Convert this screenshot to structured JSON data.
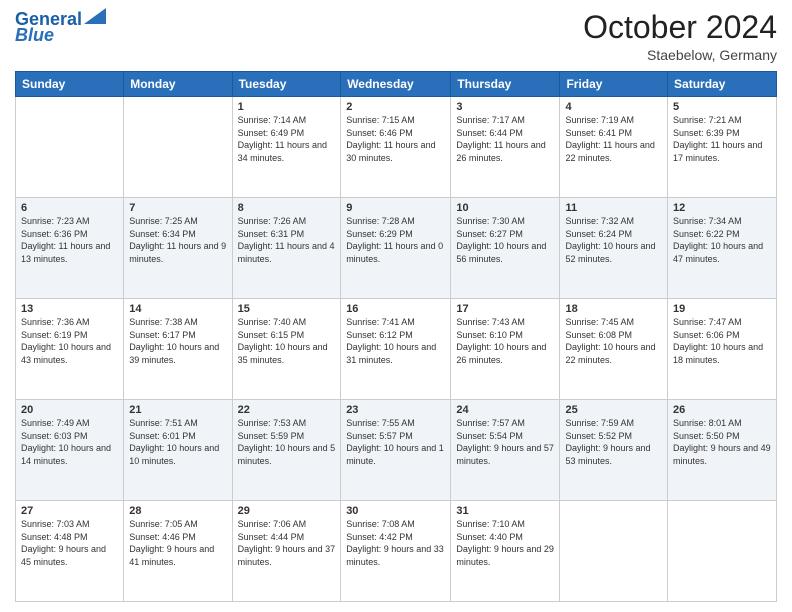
{
  "header": {
    "logo_line1": "General",
    "logo_line2": "Blue",
    "month": "October 2024",
    "location": "Staebelow, Germany"
  },
  "days_of_week": [
    "Sunday",
    "Monday",
    "Tuesday",
    "Wednesday",
    "Thursday",
    "Friday",
    "Saturday"
  ],
  "weeks": [
    [
      {
        "day": "",
        "info": ""
      },
      {
        "day": "",
        "info": ""
      },
      {
        "day": "1",
        "info": "Sunrise: 7:14 AM\nSunset: 6:49 PM\nDaylight: 11 hours and 34 minutes."
      },
      {
        "day": "2",
        "info": "Sunrise: 7:15 AM\nSunset: 6:46 PM\nDaylight: 11 hours and 30 minutes."
      },
      {
        "day": "3",
        "info": "Sunrise: 7:17 AM\nSunset: 6:44 PM\nDaylight: 11 hours and 26 minutes."
      },
      {
        "day": "4",
        "info": "Sunrise: 7:19 AM\nSunset: 6:41 PM\nDaylight: 11 hours and 22 minutes."
      },
      {
        "day": "5",
        "info": "Sunrise: 7:21 AM\nSunset: 6:39 PM\nDaylight: 11 hours and 17 minutes."
      }
    ],
    [
      {
        "day": "6",
        "info": "Sunrise: 7:23 AM\nSunset: 6:36 PM\nDaylight: 11 hours and 13 minutes."
      },
      {
        "day": "7",
        "info": "Sunrise: 7:25 AM\nSunset: 6:34 PM\nDaylight: 11 hours and 9 minutes."
      },
      {
        "day": "8",
        "info": "Sunrise: 7:26 AM\nSunset: 6:31 PM\nDaylight: 11 hours and 4 minutes."
      },
      {
        "day": "9",
        "info": "Sunrise: 7:28 AM\nSunset: 6:29 PM\nDaylight: 11 hours and 0 minutes."
      },
      {
        "day": "10",
        "info": "Sunrise: 7:30 AM\nSunset: 6:27 PM\nDaylight: 10 hours and 56 minutes."
      },
      {
        "day": "11",
        "info": "Sunrise: 7:32 AM\nSunset: 6:24 PM\nDaylight: 10 hours and 52 minutes."
      },
      {
        "day": "12",
        "info": "Sunrise: 7:34 AM\nSunset: 6:22 PM\nDaylight: 10 hours and 47 minutes."
      }
    ],
    [
      {
        "day": "13",
        "info": "Sunrise: 7:36 AM\nSunset: 6:19 PM\nDaylight: 10 hours and 43 minutes."
      },
      {
        "day": "14",
        "info": "Sunrise: 7:38 AM\nSunset: 6:17 PM\nDaylight: 10 hours and 39 minutes."
      },
      {
        "day": "15",
        "info": "Sunrise: 7:40 AM\nSunset: 6:15 PM\nDaylight: 10 hours and 35 minutes."
      },
      {
        "day": "16",
        "info": "Sunrise: 7:41 AM\nSunset: 6:12 PM\nDaylight: 10 hours and 31 minutes."
      },
      {
        "day": "17",
        "info": "Sunrise: 7:43 AM\nSunset: 6:10 PM\nDaylight: 10 hours and 26 minutes."
      },
      {
        "day": "18",
        "info": "Sunrise: 7:45 AM\nSunset: 6:08 PM\nDaylight: 10 hours and 22 minutes."
      },
      {
        "day": "19",
        "info": "Sunrise: 7:47 AM\nSunset: 6:06 PM\nDaylight: 10 hours and 18 minutes."
      }
    ],
    [
      {
        "day": "20",
        "info": "Sunrise: 7:49 AM\nSunset: 6:03 PM\nDaylight: 10 hours and 14 minutes."
      },
      {
        "day": "21",
        "info": "Sunrise: 7:51 AM\nSunset: 6:01 PM\nDaylight: 10 hours and 10 minutes."
      },
      {
        "day": "22",
        "info": "Sunrise: 7:53 AM\nSunset: 5:59 PM\nDaylight: 10 hours and 5 minutes."
      },
      {
        "day": "23",
        "info": "Sunrise: 7:55 AM\nSunset: 5:57 PM\nDaylight: 10 hours and 1 minute."
      },
      {
        "day": "24",
        "info": "Sunrise: 7:57 AM\nSunset: 5:54 PM\nDaylight: 9 hours and 57 minutes."
      },
      {
        "day": "25",
        "info": "Sunrise: 7:59 AM\nSunset: 5:52 PM\nDaylight: 9 hours and 53 minutes."
      },
      {
        "day": "26",
        "info": "Sunrise: 8:01 AM\nSunset: 5:50 PM\nDaylight: 9 hours and 49 minutes."
      }
    ],
    [
      {
        "day": "27",
        "info": "Sunrise: 7:03 AM\nSunset: 4:48 PM\nDaylight: 9 hours and 45 minutes."
      },
      {
        "day": "28",
        "info": "Sunrise: 7:05 AM\nSunset: 4:46 PM\nDaylight: 9 hours and 41 minutes."
      },
      {
        "day": "29",
        "info": "Sunrise: 7:06 AM\nSunset: 4:44 PM\nDaylight: 9 hours and 37 minutes."
      },
      {
        "day": "30",
        "info": "Sunrise: 7:08 AM\nSunset: 4:42 PM\nDaylight: 9 hours and 33 minutes."
      },
      {
        "day": "31",
        "info": "Sunrise: 7:10 AM\nSunset: 4:40 PM\nDaylight: 9 hours and 29 minutes."
      },
      {
        "day": "",
        "info": ""
      },
      {
        "day": "",
        "info": ""
      }
    ]
  ]
}
